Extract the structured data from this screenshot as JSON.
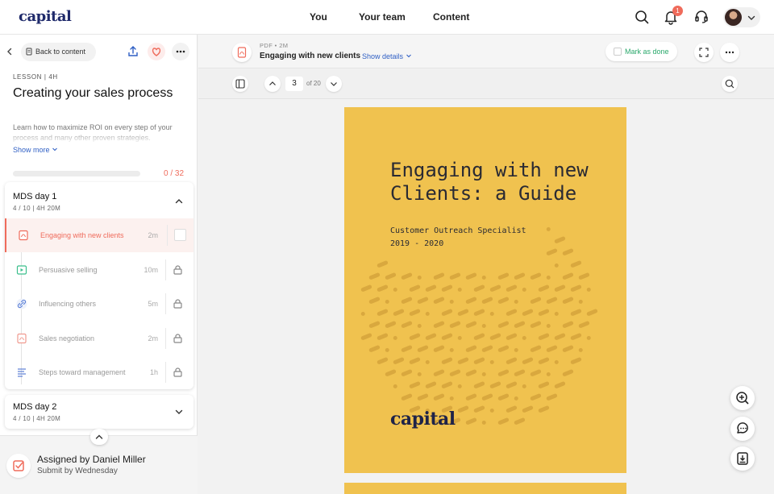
{
  "brand": {
    "logo_text": "capital"
  },
  "nav": {
    "links": [
      "You",
      "Your team",
      "Content"
    ],
    "notification_count": "1"
  },
  "sidebar": {
    "back_label": "Back to content",
    "eyebrow": "LESSON  |  4H",
    "title": "Creating your sales process",
    "description": "Learn how to maximize ROI on every step of your process and many other proven strategies.",
    "show_more": "Show more",
    "progress": {
      "text": "0 / 32",
      "fraction": 0
    },
    "sections": [
      {
        "title": "MDS day 1",
        "meta": "4 / 10  |  4H 20M",
        "expanded": true
      },
      {
        "title": "MDS day 2",
        "meta": "4 / 10  |  4H 20M",
        "expanded": false
      }
    ],
    "items": [
      {
        "label": "Engaging with new clients",
        "duration": "2m",
        "icon": "pdf-icon",
        "active": true,
        "locked": false
      },
      {
        "label": "Persuasive selling",
        "duration": "10m",
        "icon": "video-icon",
        "active": false,
        "locked": true
      },
      {
        "label": "Influencing others",
        "duration": "5m",
        "icon": "link-icon",
        "active": false,
        "locked": true
      },
      {
        "label": "Sales negotiation",
        "duration": "2m",
        "icon": "pdf-icon",
        "active": false,
        "locked": true
      },
      {
        "label": "Steps toward management",
        "duration": "1h",
        "icon": "survey-icon",
        "active": false,
        "locked": true
      }
    ],
    "assignment": {
      "title": "Assigned by Daniel Miller",
      "subtitle": "Submit by Wednesday"
    }
  },
  "viewer": {
    "meta": "PDF • 2M",
    "title": "Engaging with new clients",
    "show_details": "Show details",
    "mark_done": "Mark as done",
    "page_current": "3",
    "page_total": "of 20"
  },
  "document": {
    "title_line1": "Engaging with new",
    "title_line2": "Clients: a Guide",
    "subtitle_line1": "Customer Outreach Specialist",
    "subtitle_line2": "2019 - 2020",
    "logo_text": "capital"
  },
  "colors": {
    "accent": "#ef6b5b",
    "brand": "#1f2a6b",
    "link": "#2f5fc4",
    "success": "#2aa86b",
    "cover": "#f0c24f"
  }
}
